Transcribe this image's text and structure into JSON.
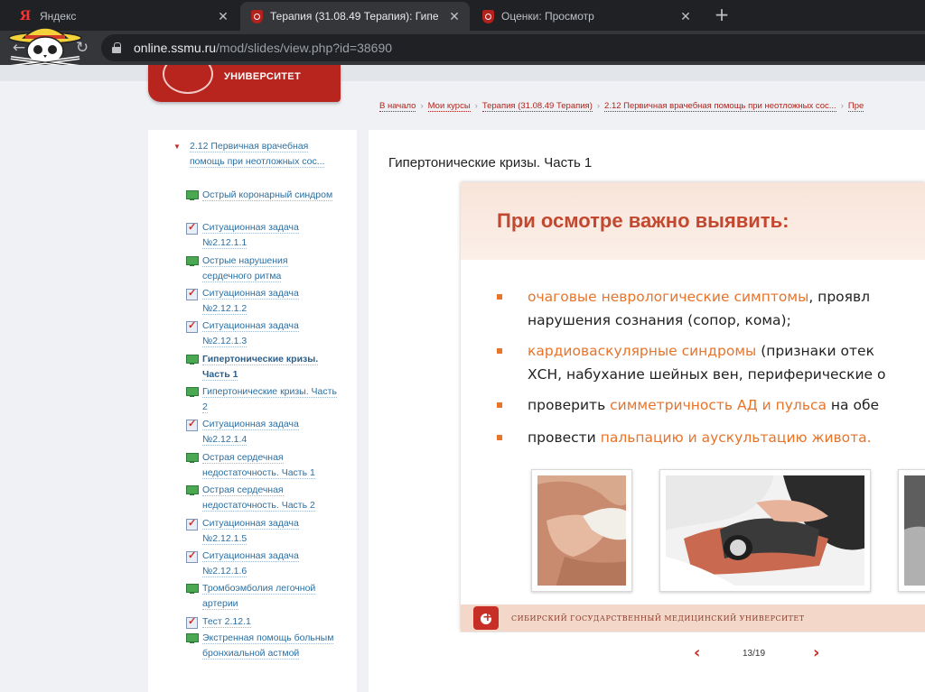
{
  "browser": {
    "tabs": [
      {
        "title": "Яндекс",
        "active": false,
        "favicon": "yandex-icon"
      },
      {
        "title": "Терапия (31.08.49 Терапия): Гипе",
        "active": true,
        "favicon": "ssmu-icon"
      },
      {
        "title": "Оценки: Просмотр",
        "active": false,
        "favicon": "ssmu-icon"
      }
    ],
    "close_glyph": "✕",
    "new_tab_glyph": "+",
    "back_glyph": "←",
    "reload_glyph": "↻",
    "url_host": "online.ssmu.ru",
    "url_path": "/mod/slides/view.php?id=38690"
  },
  "site": {
    "logo_text": "УНИВЕРСИТЕТ"
  },
  "breadcrumb": [
    "В начало",
    "Мои курсы",
    "Терапия (31.08.49 Терапия)",
    "2.12 Первичная врачебная помощь при неотложных сос...",
    "Пре"
  ],
  "breadcrumb_sep": "›",
  "sidebar": {
    "section_title": "2.12 Первичная врачебная помощь при неотложных сос...",
    "section_arrow": "▼",
    "items": [
      {
        "label": "Острый коронарный синдром",
        "icon": "presentation-icon",
        "current": false
      },
      {
        "label": "Ситуационная задача №2.12.1.1",
        "icon": "task-icon",
        "current": false
      },
      {
        "label": "Острые нарушения сердечного ритма",
        "icon": "presentation-icon",
        "current": false
      },
      {
        "label": "Ситуационная задача №2.12.1.2",
        "icon": "task-icon",
        "current": false
      },
      {
        "label": "Ситуационная задача №2.12.1.3",
        "icon": "task-icon",
        "current": false
      },
      {
        "label": "Гипертонические кризы. Часть 1",
        "icon": "presentation-icon",
        "current": true
      },
      {
        "label": "Гипертонические кризы. Часть 2",
        "icon": "presentation-icon",
        "current": false
      },
      {
        "label": "Ситуационная задача №2.12.1.4",
        "icon": "task-icon",
        "current": false
      },
      {
        "label": "Острая сердечная недостаточность. Часть 1",
        "icon": "presentation-icon",
        "current": false
      },
      {
        "label": "Острая сердечная недостаточность. Часть 2",
        "icon": "presentation-icon",
        "current": false
      },
      {
        "label": "Ситуационная задача №2.12.1.5",
        "icon": "task-icon",
        "current": false
      },
      {
        "label": "Ситуационная задача №2.12.1.6",
        "icon": "task-icon",
        "current": false
      },
      {
        "label": "Тромбоэмболия легочной артерии",
        "icon": "presentation-icon",
        "current": false
      },
      {
        "label": "Тест 2.12.1",
        "icon": "task-icon",
        "current": false
      },
      {
        "label": "Экстренная помощь больным бронхиальной астмой",
        "icon": "presentation-icon",
        "current": false
      }
    ]
  },
  "content": {
    "title": "Гипертонические кризы. Часть 1"
  },
  "slide": {
    "title": "При осмотре важно выявить:",
    "bullets": [
      {
        "lines": [
          [
            {
              "t": "очаговые неврологические симптомы",
              "hl": true
            },
            {
              "t": ", проявл",
              "hl": false
            }
          ],
          [
            {
              "t": "нарушения сознания (сопор,  кома);",
              "hl": false
            }
          ]
        ]
      },
      {
        "lines": [
          [
            {
              "t": "кардиоваскулярные синдромы",
              "hl": true
            },
            {
              "t": " (признаки отек",
              "hl": false
            }
          ],
          [
            {
              "t": "ХСН, набухание шейных вен, периферические о",
              "hl": false
            }
          ]
        ]
      },
      {
        "lines": [
          [
            {
              "t": "проверить ",
              "hl": false
            },
            {
              "t": "симметричность АД и пульса",
              "hl": true
            },
            {
              "t": " на обе",
              "hl": false
            }
          ]
        ]
      },
      {
        "lines": [
          [
            {
              "t": "провести ",
              "hl": false
            },
            {
              "t": "пальпацию и аускультацию живота.",
              "hl": true
            }
          ]
        ]
      }
    ],
    "footer_text": "СИБИРСКИЙ ГОСУДАРСТВЕННЫЙ МЕДИЦИНСКИЙ УНИВЕРСИТЕТ",
    "accent_color": "#e8742a",
    "title_color": "#c2482f"
  },
  "pager": {
    "prev": "‹",
    "next": "›",
    "counter": "13/19"
  }
}
